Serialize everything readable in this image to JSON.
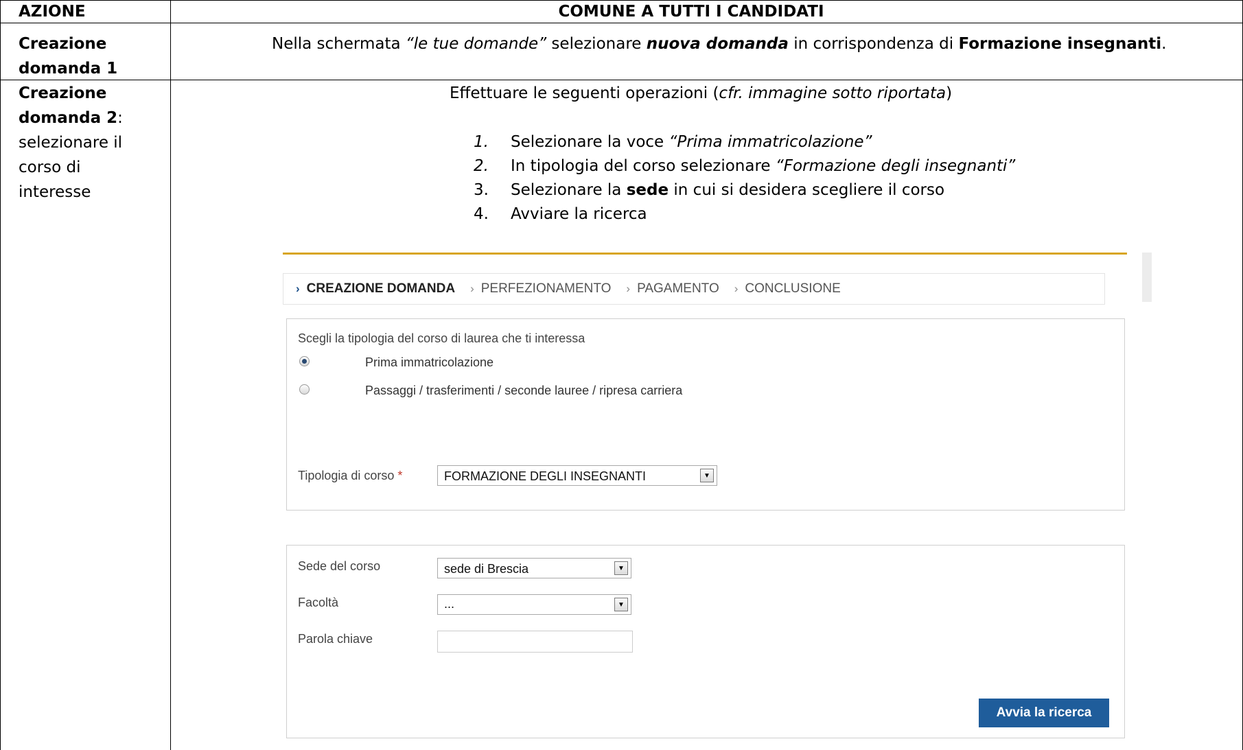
{
  "table": {
    "col_header_action": "AZIONE",
    "col_header_common": "COMUNE A TUTTI I CANDIDATI",
    "row1": {
      "action_line1": "Creazione",
      "action_line2": "domanda 1",
      "text_part1": "Nella schermata ",
      "text_part2": "“le tue domande”",
      "text_part3": " selezionare  ",
      "text_part4": "nuova domanda",
      "text_part5": " in corrispondenza di ",
      "text_part6": "Formazione insegnanti",
      "text_part7": "."
    },
    "row2": {
      "action_line1": "Creazione",
      "action_line2_bold": "domanda 2",
      "action_line2_rest": ":",
      "action_line3": "selezionare il",
      "action_line4": "corso di",
      "action_line5": "interesse",
      "intro_part1": "Effettuare le seguenti operazioni  (",
      "intro_part2": "cfr. immagine sotto riportata",
      "intro_part3": ")",
      "steps": [
        {
          "num": "1.",
          "text1": "Selezionare la voce ",
          "em": "“Prima immatricolazione”",
          "text2": ""
        },
        {
          "num": "2.",
          "text1": "In tipologia del corso selezionare ",
          "em": "“Formazione degli insegnanti”",
          "text2": ""
        },
        {
          "num": "3.",
          "text1": "Selezionare la ",
          "strong": "sede",
          "text2": " in cui si desidera scegliere il corso"
        },
        {
          "num": "4.",
          "text1": "Avviare la ricerca"
        }
      ]
    }
  },
  "screenshot": {
    "steps_bar": [
      {
        "label": "CREAZIONE DOMANDA",
        "active": true
      },
      {
        "label": "PERFEZIONAMENTO",
        "active": false
      },
      {
        "label": "PAGAMENTO",
        "active": false
      },
      {
        "label": "CONCLUSIONE",
        "active": false
      }
    ],
    "chevron": "›",
    "course_type_question": "Scegli la tipologia del corso di laurea che ti interessa",
    "radio_options": [
      {
        "label": "Prima immatricolazione",
        "selected": true
      },
      {
        "label": "Passaggi / trasferimenti / seconde lauree / ripresa carriera",
        "selected": false
      }
    ],
    "course_type_label": "Tipologia di corso",
    "required_mark": "*",
    "course_type_value": "FORMAZIONE DEGLI INSEGNANTI",
    "sede_label": "Sede del corso",
    "sede_value": "sede di Brescia",
    "facolta_label": "Facoltà",
    "facolta_value": "...",
    "keyword_label": "Parola chiave",
    "keyword_value": "",
    "search_button": "Avvia la ricerca",
    "colors": {
      "accent_gold": "#d8a520",
      "button_blue": "#1f5d9b"
    }
  }
}
